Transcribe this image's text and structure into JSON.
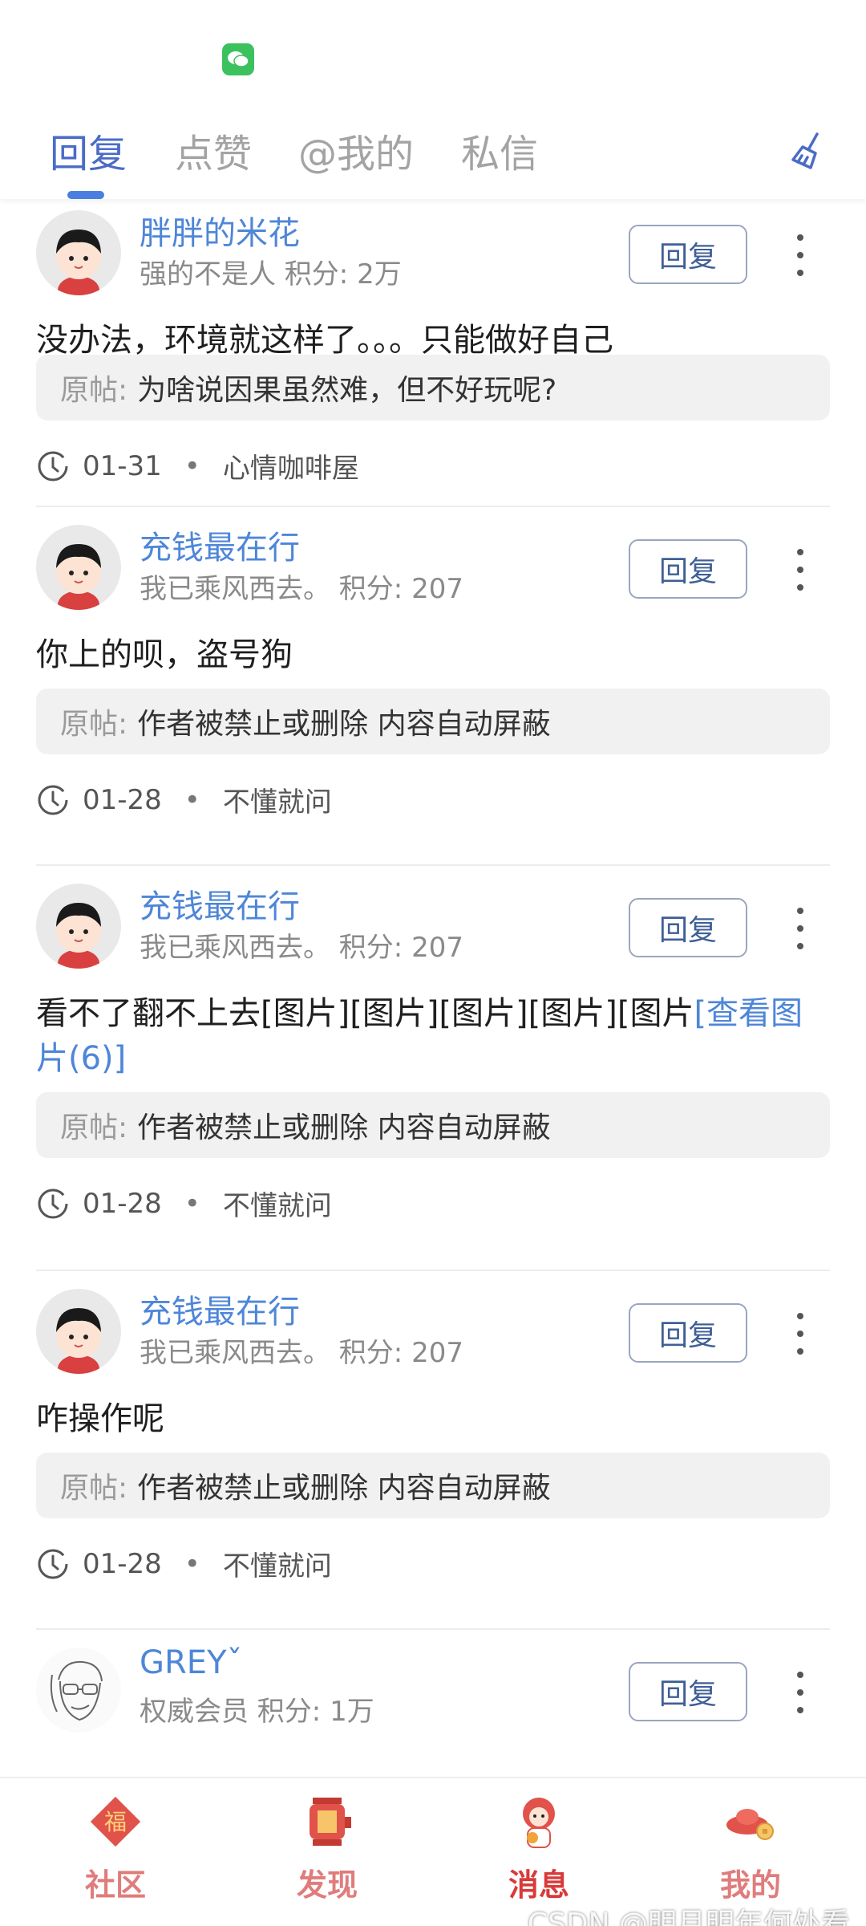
{
  "tabs": [
    {
      "label": "回复",
      "active": true
    },
    {
      "label": "点赞",
      "active": false
    },
    {
      "label": "@我的",
      "active": false
    },
    {
      "label": "私信",
      "active": false
    }
  ],
  "quote_label": "原帖:",
  "reply_label": "回复",
  "items": [
    {
      "name": "胖胖的米花",
      "meta": "强的不是人 积分: 2万",
      "content": "没办法，环境就这样了。。。只能做好自己",
      "quote": "为啥说因果虽然难，但不好玩呢?",
      "date": "01-31",
      "board": "心情咖啡屋"
    },
    {
      "name": "充钱最在行",
      "meta": "我已乘风西去。 积分: 207",
      "content": "你上的呗，盗号狗",
      "quote": "作者被禁止或删除 内容自动屏蔽",
      "date": "01-28",
      "board": "不懂就问"
    },
    {
      "name": "充钱最在行",
      "meta": "我已乘风西去。 积分: 207",
      "content": "看不了翻不上去[图片][图片][图片][图片][图片",
      "content_link": "[查看图片(6)]",
      "quote": "作者被禁止或删除 内容自动屏蔽",
      "date": "01-28",
      "board": "不懂就问"
    },
    {
      "name": "充钱最在行",
      "meta": "我已乘风西去。 积分: 207",
      "content": "咋操作呢",
      "quote": "作者被禁止或删除 内容自动屏蔽",
      "date": "01-28",
      "board": "不懂就问"
    },
    {
      "name": "GREYˇ",
      "meta": "权威会员 积分: 1万"
    }
  ],
  "bottom_nav": [
    {
      "label": "社区",
      "icon": "fu-icon"
    },
    {
      "label": "发现",
      "icon": "lantern-icon"
    },
    {
      "label": "消息",
      "icon": "mascot-icon"
    },
    {
      "label": "我的",
      "icon": "ingot-icon"
    }
  ],
  "watermark": "CSDN @明月明年何处看",
  "colors": {
    "accent": "#4a6cc8",
    "link": "#4e86d8",
    "nav": "#e07c7c"
  }
}
